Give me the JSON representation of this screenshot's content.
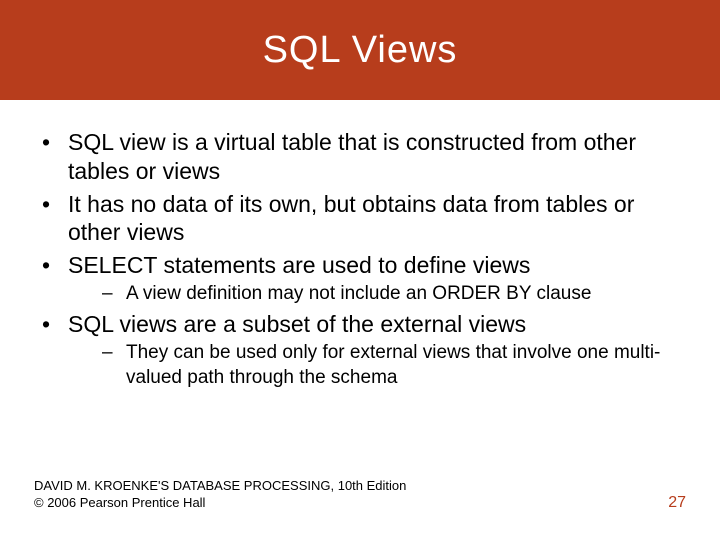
{
  "title": "SQL Views",
  "bullets": {
    "b1": "SQL view is a virtual table that is constructed from other tables or views",
    "b2": "It has no data of its own, but obtains data from tables or other views",
    "b3": "SELECT statements are used to define views",
    "b3_sub1": "A view definition may not include an ORDER BY clause",
    "b4": "SQL views are a subset of the external views",
    "b4_sub1": "They can be used only for external views that involve one multi-valued path through the schema"
  },
  "footer": {
    "line1": "DAVID M. KROENKE'S DATABASE PROCESSING, 10th Edition",
    "line2": "© 2006 Pearson Prentice Hall",
    "page": "27"
  }
}
